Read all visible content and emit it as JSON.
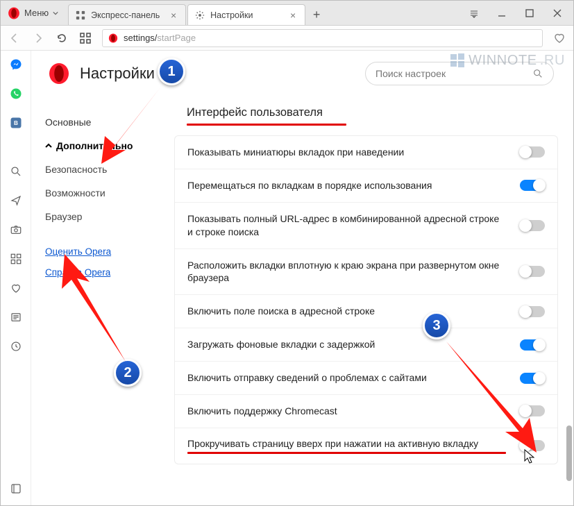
{
  "window": {
    "menu_label": "Меню"
  },
  "tabs": [
    {
      "label": "Экспресс-панель",
      "active": false
    },
    {
      "label": "Настройки",
      "active": true
    }
  ],
  "address": {
    "base": "settings/",
    "tail": "startPage"
  },
  "watermark": {
    "brand": "WINNOTE",
    "ext": ".RU"
  },
  "settings": {
    "page_title": "Настройки",
    "search_placeholder": "Поиск настроек",
    "nav": {
      "basic": "Основные",
      "advanced": "Дополнительно",
      "security": "Безопасность",
      "features": "Возможности",
      "browser": "Браузер",
      "rate": "Оценить Opera",
      "help": "Справка Opera"
    },
    "section_title": "Интерфейс пользователя",
    "rows": [
      {
        "text": "Показывать миниатюры вкладок при наведении",
        "on": false
      },
      {
        "text": "Перемещаться по вкладкам в порядке использования",
        "on": true
      },
      {
        "text": "Показывать полный URL-адрес в комбинированной адресной строке и строке поиска",
        "on": false
      },
      {
        "text": "Расположить вкладки вплотную к краю экрана при развернутом окне браузера",
        "on": false
      },
      {
        "text": "Включить поле поиска в адресной строке",
        "on": false
      },
      {
        "text": "Загружать фоновые вкладки с задержкой",
        "on": true
      },
      {
        "text": "Включить отправку сведений о проблемах с сайтами",
        "on": true
      },
      {
        "text": "Включить поддержку Chromecast",
        "on": false
      },
      {
        "text": "Прокручивать страницу вверх при нажатии на активную вкладку",
        "on": false
      }
    ]
  },
  "annotations": {
    "badge1": "1",
    "badge2": "2",
    "badge3": "3"
  }
}
